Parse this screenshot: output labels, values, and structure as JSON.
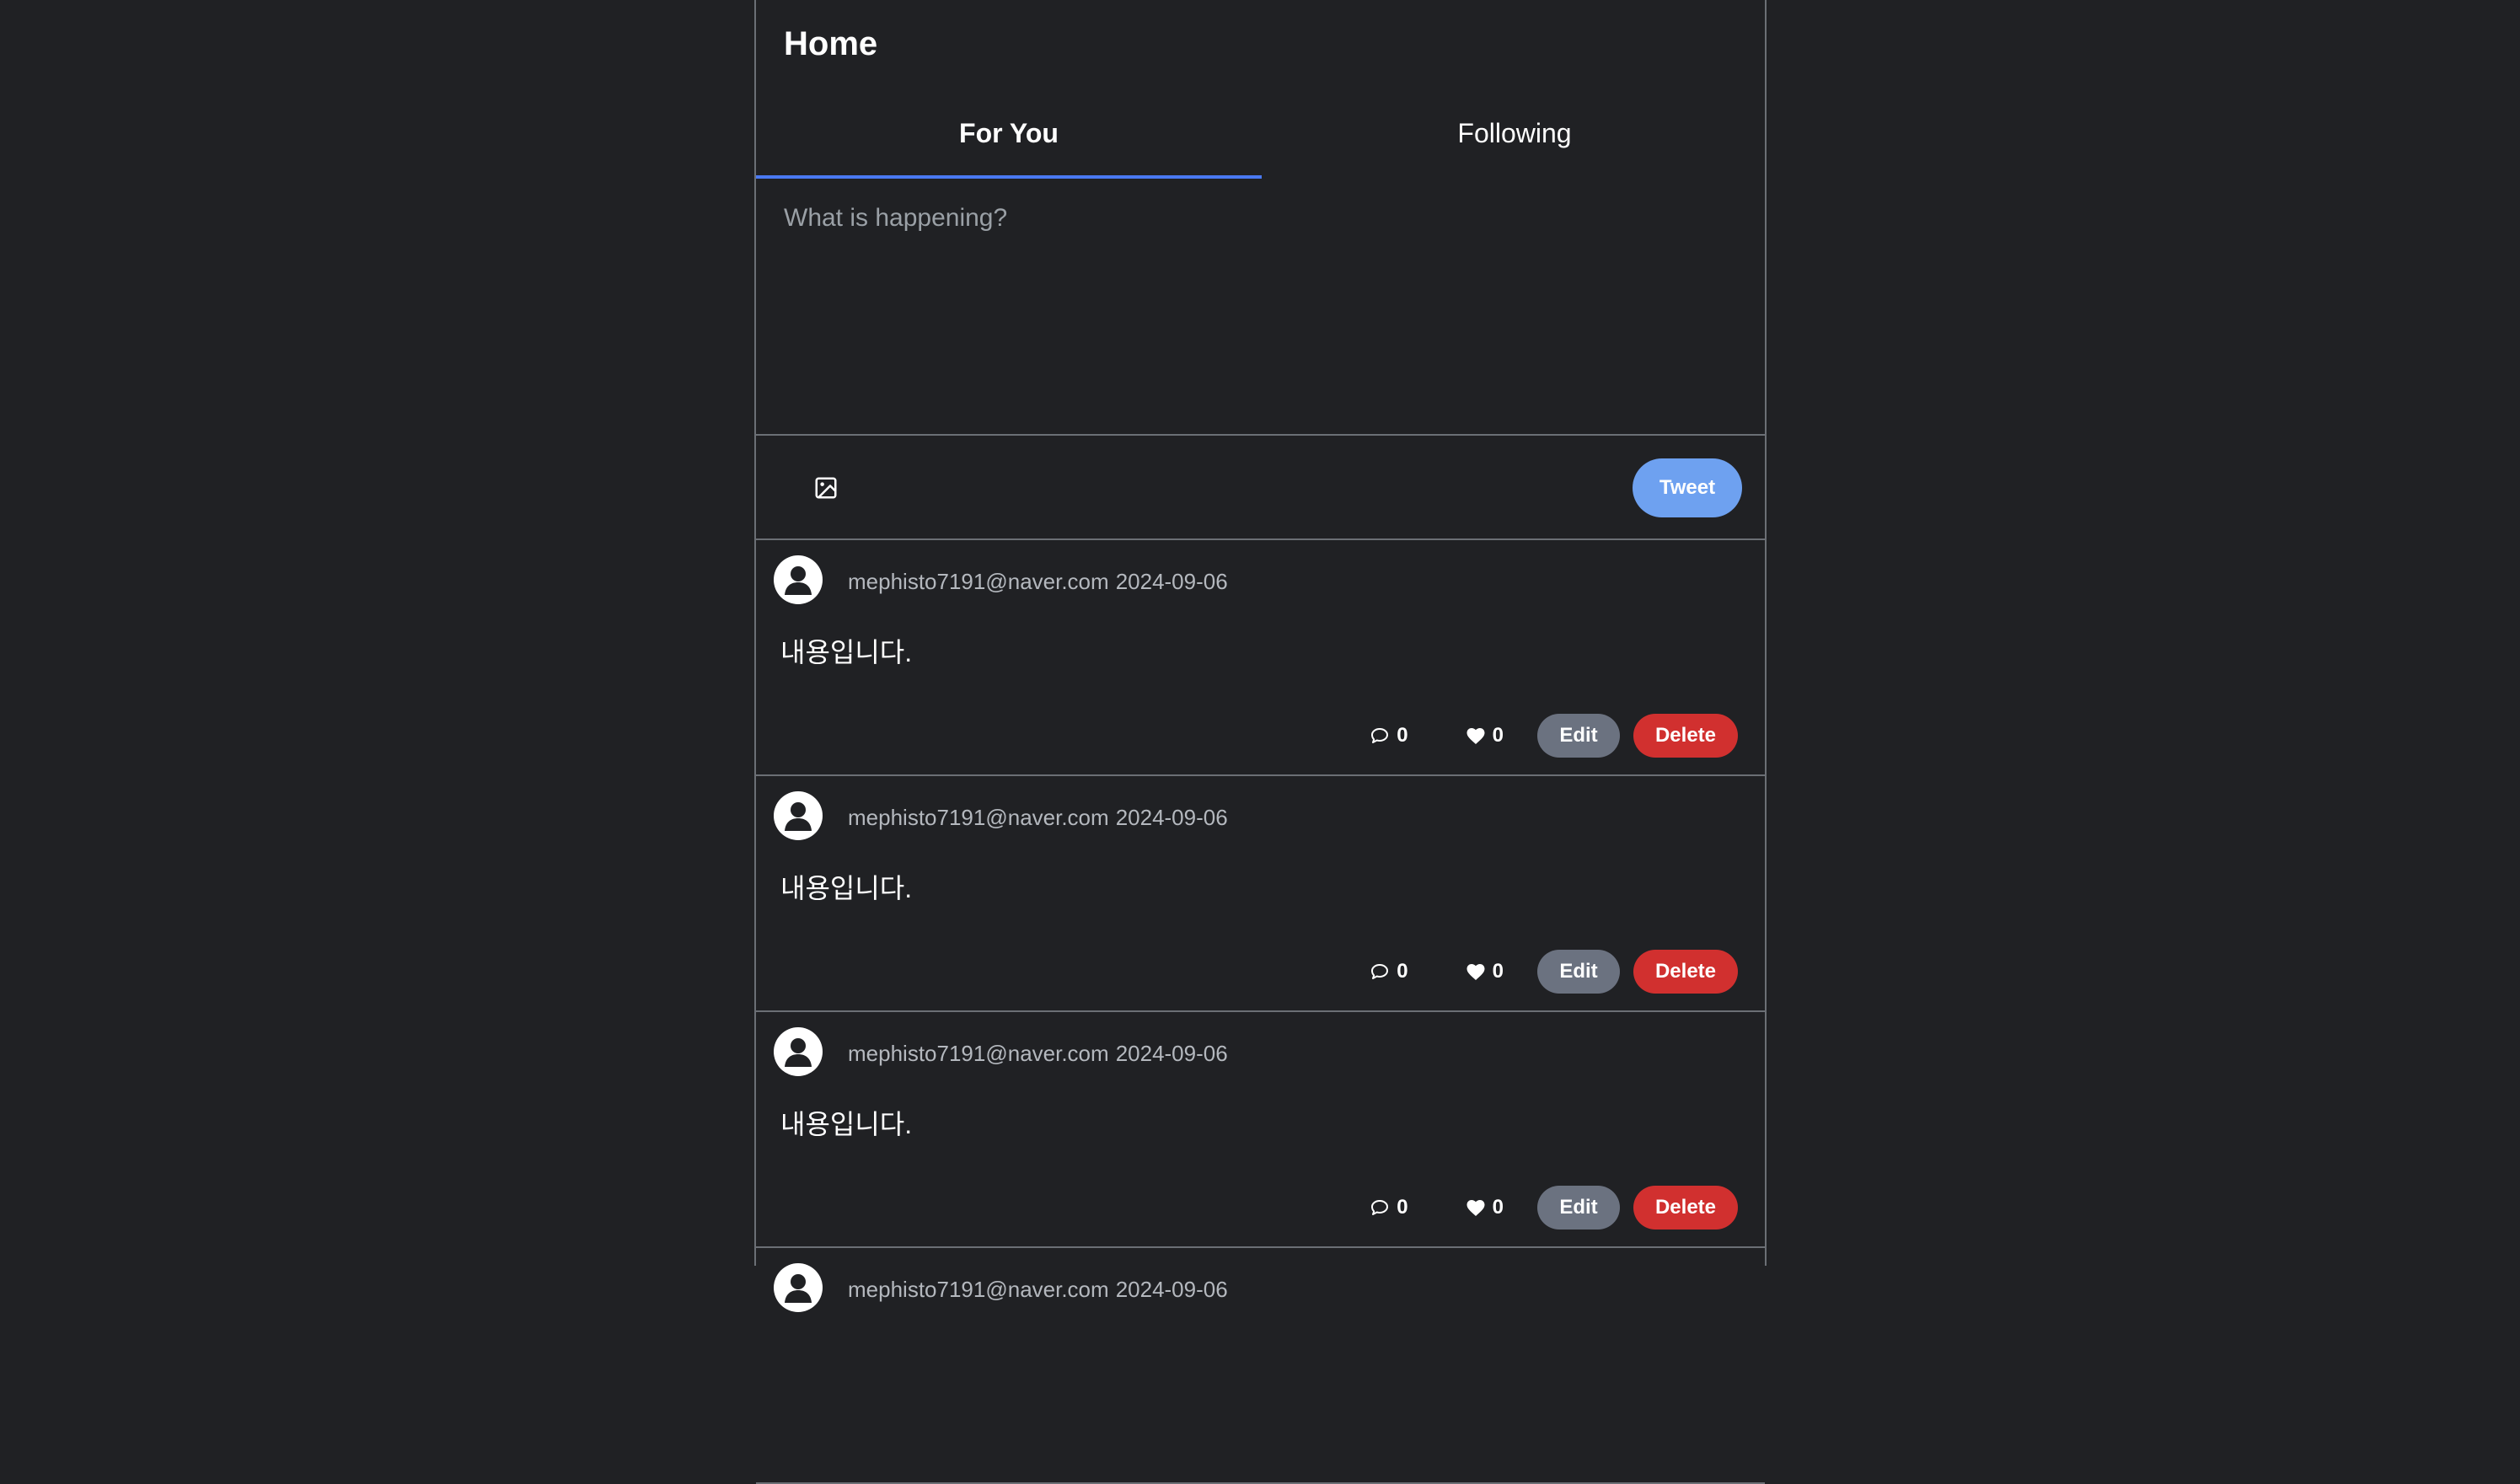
{
  "header": {
    "title": "Home"
  },
  "tabs": [
    {
      "label": "For You",
      "active": true
    },
    {
      "label": "Following",
      "active": false
    }
  ],
  "composer": {
    "placeholder": "What is happening?",
    "value": "",
    "image_icon": "image-icon",
    "submit_label": "Tweet"
  },
  "colors": {
    "background": "#202124",
    "accent": "#4a79f2",
    "tweet_button": "#6ea1f0",
    "edit_button": "#6b7280",
    "delete_button": "#d1302f"
  },
  "posts": [
    {
      "author": "mephisto7191@naver.com",
      "date": "2024-09-06",
      "content": "내용입니다.",
      "comments": "0",
      "likes": "0",
      "edit_label": "Edit",
      "delete_label": "Delete"
    },
    {
      "author": "mephisto7191@naver.com",
      "date": "2024-09-06",
      "content": "내용입니다.",
      "comments": "0",
      "likes": "0",
      "edit_label": "Edit",
      "delete_label": "Delete"
    },
    {
      "author": "mephisto7191@naver.com",
      "date": "2024-09-06",
      "content": "내용입니다.",
      "comments": "0",
      "likes": "0",
      "edit_label": "Edit",
      "delete_label": "Delete"
    },
    {
      "author": "mephisto7191@naver.com",
      "date": "2024-09-06",
      "content": "",
      "comments": "",
      "likes": "",
      "edit_label": "",
      "delete_label": ""
    }
  ]
}
